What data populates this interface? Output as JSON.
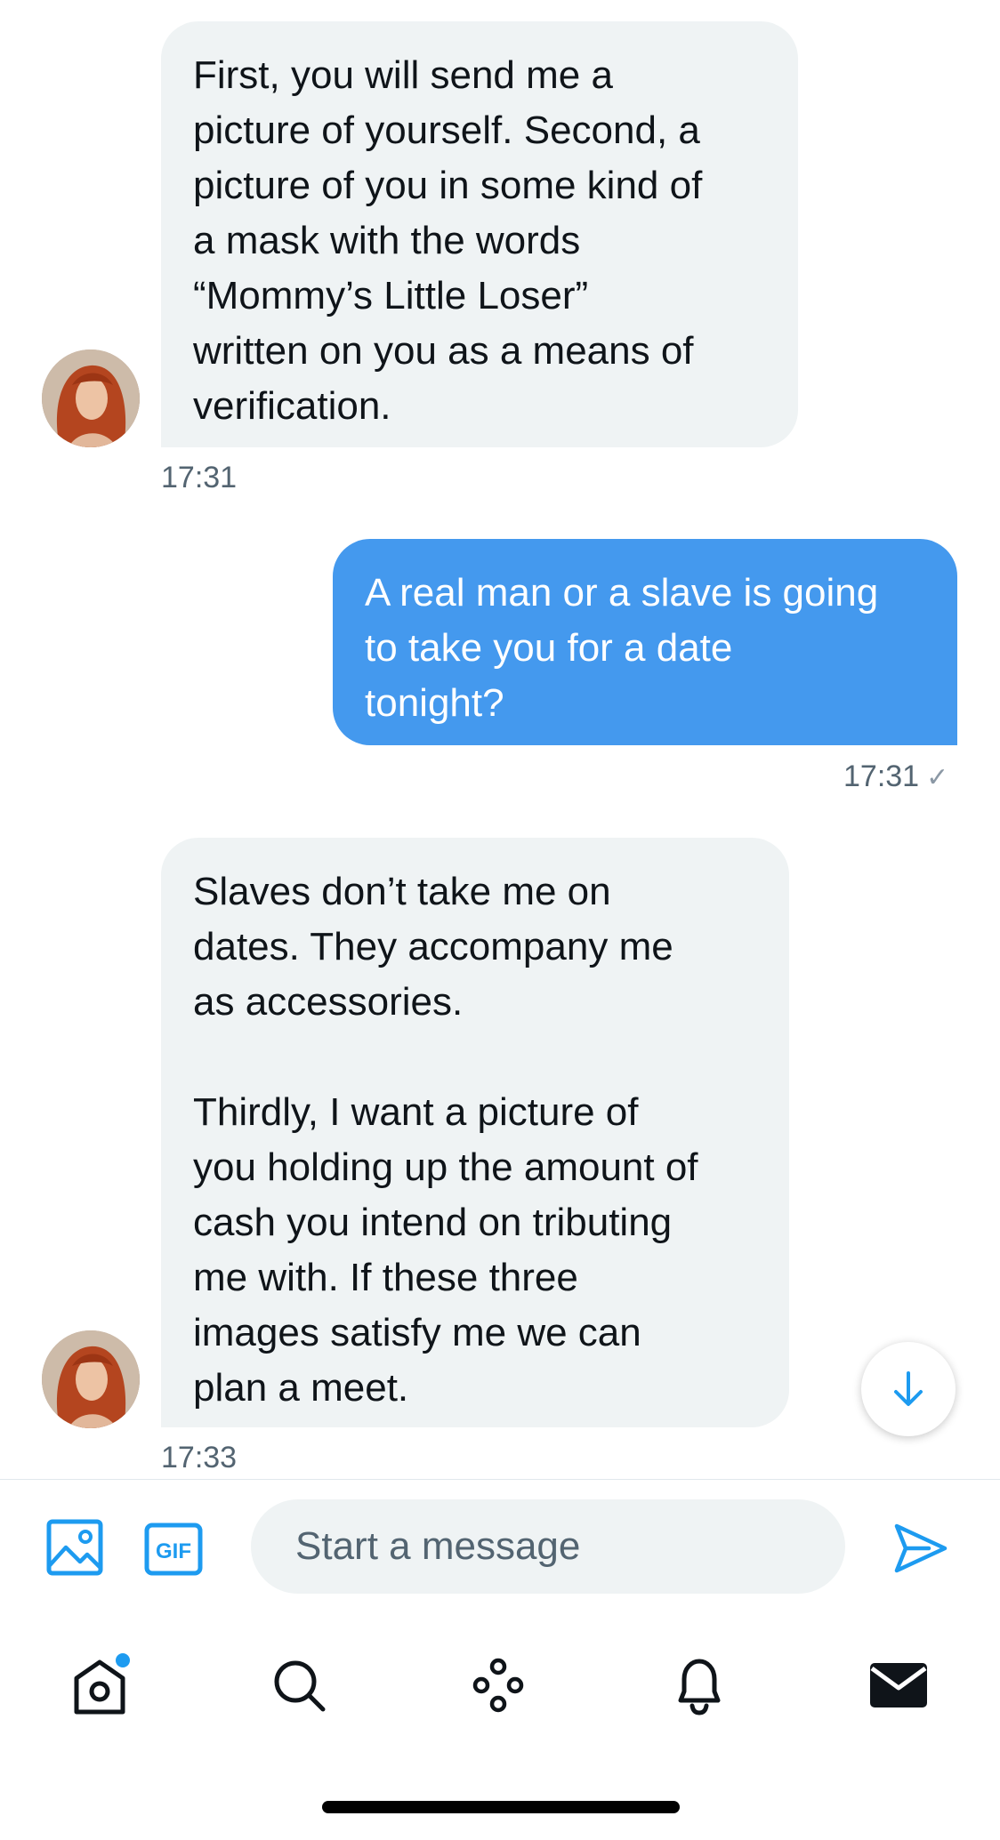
{
  "messages": [
    {
      "direction": "incoming",
      "text": "First, you will send me a\npicture of yourself. Second, a\npicture of you in some kind of\na mask with the words\n“Mommy’s Little Loser”\nwritten on you as a means of\nverification.",
      "time": "17:31"
    },
    {
      "direction": "outgoing",
      "text": "A real man or a slave is going\nto take you for a date\ntonight?",
      "time": "17:31",
      "status_icon": "✓"
    },
    {
      "direction": "incoming",
      "text": "Slaves don’t take me on\ndates. They accompany me\nas accessories.\n\nThirdly, I want a picture of\nyou holding up the amount of\ncash you intend on tributing\nme with. If these three\nimages satisfy me we can\nplan a meet.",
      "time": "17:33"
    }
  ],
  "composer": {
    "placeholder": "Start a message",
    "gif_label": "GIF"
  },
  "icons": {
    "scroll_down": "arrow-down-icon",
    "image": "image-icon",
    "gif": "gif-icon",
    "send": "send-icon",
    "home": "home-icon",
    "search": "search-icon",
    "spaces": "spaces-icon",
    "notifications": "bell-icon",
    "messages": "mail-icon"
  },
  "colors": {
    "accent": "#1d9bf0",
    "outgoing_bubble": "#4499ee",
    "incoming_bubble": "#eff3f4",
    "timestamp": "#536471"
  },
  "tabbar": {
    "home_has_notification": true,
    "active": "messages"
  }
}
